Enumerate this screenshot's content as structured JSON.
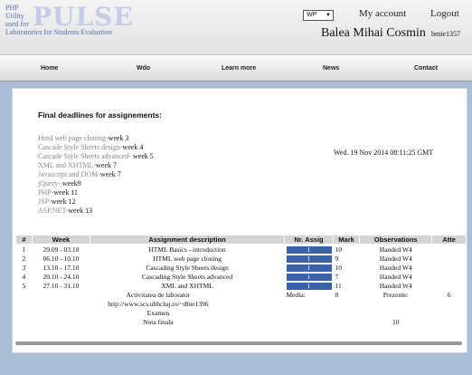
{
  "header": {
    "logo_small": [
      "PHP",
      "Utility",
      "used for",
      "Laboratories for Students Evaluation"
    ],
    "logo_big": "PULSE",
    "lang_select": "WP",
    "my_account": "My account",
    "logout": "Logout",
    "user_name": "Balea Mihai Cosmin",
    "user_id": "bmie1357"
  },
  "nav": [
    "Home",
    "Wdo",
    "Learn more",
    "News",
    "Contact"
  ],
  "deadlines": {
    "title": "Final deadlines for assignements:",
    "items": [
      {
        "topic": "Html web page cloning-",
        "week": "week 3"
      },
      {
        "topic": "Cascade Style Sheets design-",
        "week": "week 4"
      },
      {
        "topic": "Cascade Style Sheets advanced- ",
        "week": "week 5"
      },
      {
        "topic": "XML and XHTML-",
        "week": "week 7"
      },
      {
        "topic": "Javascript and DOM-",
        "week": "week 7"
      },
      {
        "topic": "jQuery- ",
        "week": "week9"
      },
      {
        "topic": "PHP-",
        "week": "week 11"
      },
      {
        "topic": "JSP-",
        "week": "week 12"
      },
      {
        "topic": "ASP.NET-",
        "week": "week 13"
      }
    ],
    "server_time": "Wed. 19 Nov 2014 08:11:25 GMT"
  },
  "table": {
    "headers": [
      "#",
      "Week",
      "Assignment description",
      "Nr. Assig",
      "Mark",
      "Observations",
      "Atte"
    ],
    "rows": [
      {
        "n": "1",
        "week": "29.09 - 03.10",
        "desc": "HTML Basics - introduction",
        "assig": "1",
        "mark": "10",
        "obs": "Handed W4"
      },
      {
        "n": "2",
        "week": "06.10 - 10.10",
        "desc": "HTML web page cloning",
        "assig": "1",
        "mark": "9",
        "obs": "Handed W4"
      },
      {
        "n": "3",
        "week": "13.10 - 17.10",
        "desc": "Cascading Style Sheets design",
        "assig": "1",
        "mark": "10",
        "obs": "Handed W4"
      },
      {
        "n": "4",
        "week": "20.10 - 24.10",
        "desc": "Cascading Style Sheets advanced",
        "assig": "1",
        "mark": "7",
        "obs": "Handed W4"
      },
      {
        "n": "5",
        "week": "27.10 - 31.10",
        "desc": "XML and XHTML",
        "assig": "1",
        "mark": "11",
        "obs": "Handed W4"
      }
    ],
    "activity_label": "Activitatea de laborator",
    "media_label": "Media:",
    "media_value": "8",
    "prezente_label": "Prezente:",
    "prezente_value": "6",
    "url": "http://www.scs.ubbcluj.ro/~dbie1396",
    "examen_label": "Examen",
    "nota_label": "Nota finala",
    "nota_value": "10"
  },
  "colors": {
    "accent_bar": "#3a62a8",
    "background": "#a9bed6"
  }
}
